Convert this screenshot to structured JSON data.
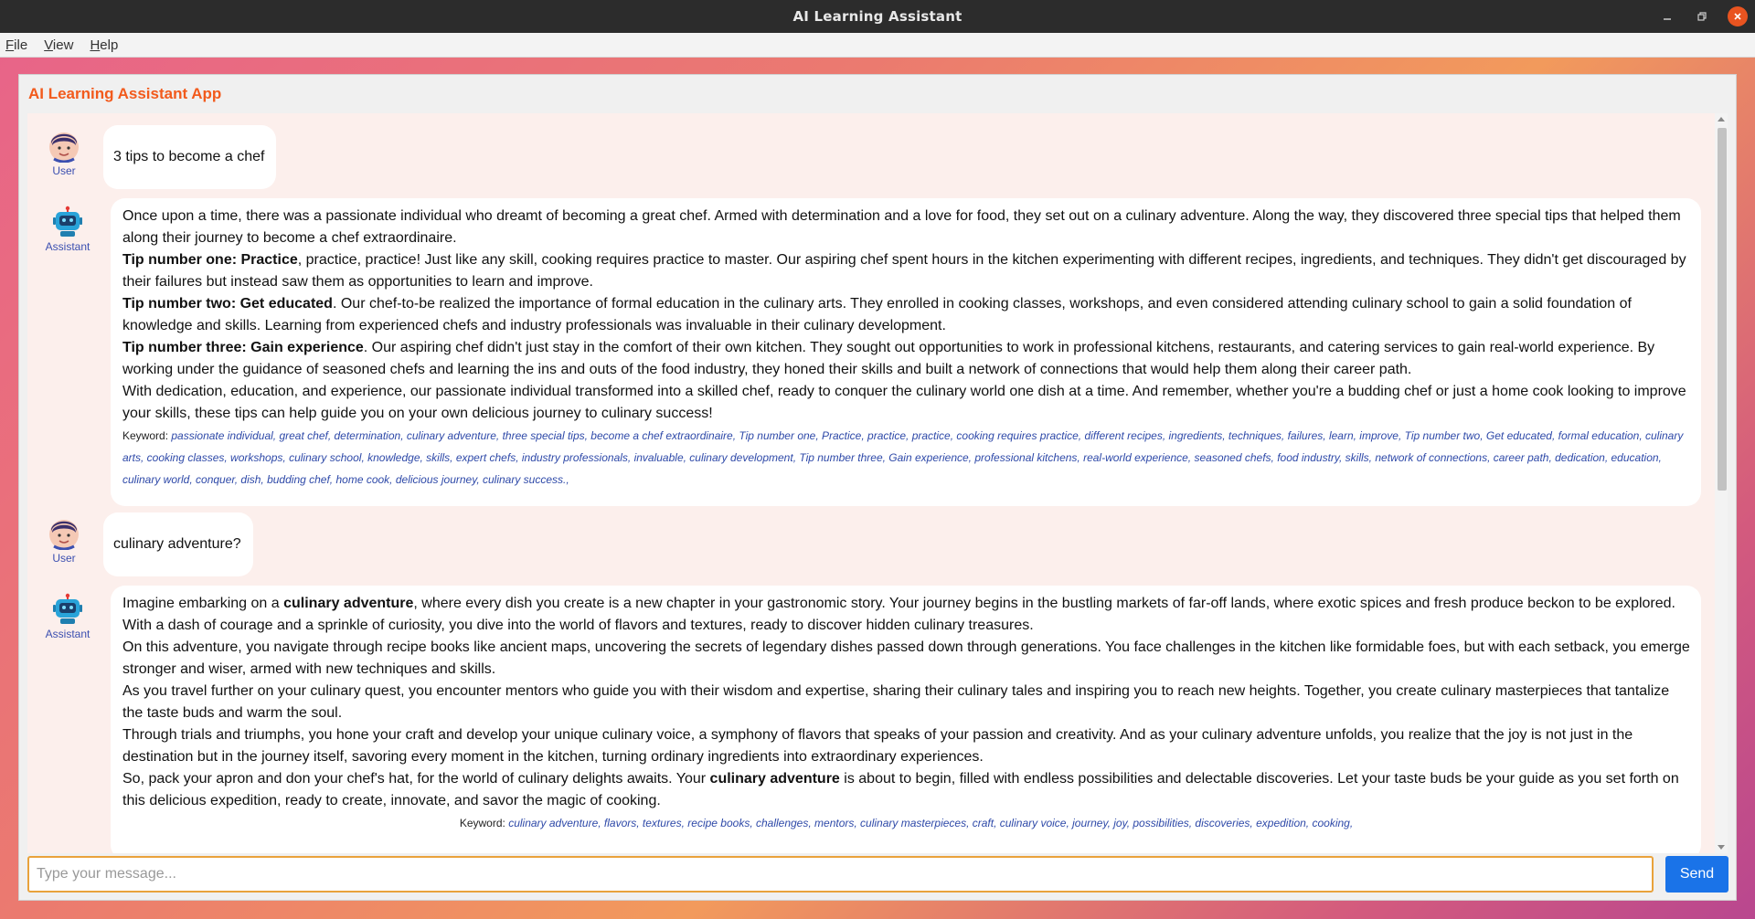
{
  "window": {
    "title": "AI Learning Assistant"
  },
  "menu": [
    {
      "underline": "F",
      "rest": "ile"
    },
    {
      "underline": "V",
      "rest": "iew"
    },
    {
      "underline": "H",
      "rest": "elp"
    }
  ],
  "app": {
    "title": "AI Learning Assistant App"
  },
  "labels": {
    "user": "User",
    "assistant": "Assistant",
    "keyword": "Keyword:"
  },
  "messages": {
    "m1": {
      "text": "3 tips to become a chef"
    },
    "m2": {
      "p1": "Once upon a time, there was a passionate individual who dreamt of becoming a great chef. Armed with determination and a love for food, they set out on a culinary adventure. Along the way, they discovered three special tips that helped them along their journey to become a chef extraordinaire.",
      "p2_b": "Tip number one: Practice",
      "p2": ", practice, practice! Just like any skill, cooking requires practice to master. Our aspiring chef spent hours in the kitchen experimenting with different recipes, ingredients, and techniques. They didn't get discouraged by their failures but instead saw them as opportunities to learn and improve.",
      "p3_b": "Tip number two: Get educated",
      "p3": ". Our chef-to-be realized the importance of formal education in the culinary arts. They enrolled in cooking classes, workshops, and even considered attending culinary school to gain a solid foundation of knowledge and skills. Learning from experienced chefs and industry professionals was invaluable in their culinary development.",
      "p4_b": "Tip number three: Gain experience",
      "p4": ". Our aspiring chef didn't just stay in the comfort of their own kitchen. They sought out opportunities to work in professional kitchens, restaurants, and catering services to gain real-world experience. By working under the guidance of seasoned chefs and learning the ins and outs of the food industry, they honed their skills and built a network of connections that would help them along their career path.",
      "p5": "With dedication, education, and experience, our passionate individual transformed into a skilled chef, ready to conquer the culinary world one dish at a time. And remember, whether you're a budding chef or just a home cook looking to improve your skills, these tips can help guide you on your own delicious journey to culinary success!",
      "keywords": "passionate individual, great chef, determination, culinary adventure, three special tips, become a chef extraordinaire, Tip number one, Practice, practice, practice, cooking requires practice, different recipes, ingredients, techniques, failures, learn, improve, Tip number two, Get educated, formal education, culinary arts, cooking classes, workshops, culinary school, knowledge, skills, expert chefs, industry professionals, invaluable, culinary development, Tip number three, Gain experience, professional kitchens, real-world experience, seasoned chefs, food industry, skills, network of connections, career path, dedication, education, culinary world, conquer, dish, budding chef, home cook, delicious journey, culinary success.,"
    },
    "m3": {
      "text": "culinary adventure?"
    },
    "m4": {
      "p1_a": "Imagine embarking on a ",
      "p1_b": "culinary adventure",
      "p1_c": ", where every dish you create is a new chapter in your gastronomic story. Your journey begins in the bustling markets of far-off lands, where exotic spices and fresh produce beckon to be explored. With a dash of courage and a sprinkle of curiosity, you dive into the world of flavors and textures, ready to discover hidden culinary treasures.",
      "p2": "On this adventure, you navigate through recipe books like ancient maps, uncovering the secrets of legendary dishes passed down through generations. You face challenges in the kitchen like formidable foes, but with each setback, you emerge stronger and wiser, armed with new techniques and skills.",
      "p3": "As you travel further on your culinary quest, you encounter mentors who guide you with their wisdom and expertise, sharing their culinary tales and inspiring you to reach new heights. Together, you create culinary masterpieces that tantalize the taste buds and warm the soul.",
      "p4": "Through trials and triumphs, you hone your craft and develop your unique culinary voice, a symphony of flavors that speaks of your passion and creativity. And as your culinary adventure unfolds, you realize that the joy is not just in the destination but in the journey itself, savoring every moment in the kitchen, turning ordinary ingredients into extraordinary experiences.",
      "p5_a": "So, pack your apron and don your chef's hat, for the world of culinary delights awaits. Your ",
      "p5_b": "culinary adventure",
      "p5_c": " is about to begin, filled with endless possibilities and delectable discoveries. Let your taste buds be your guide as you set forth on this delicious expedition, ready to create, innovate, and savor the magic of cooking.",
      "keywords": "culinary adventure, flavors, textures, recipe books, challenges, mentors, culinary masterpieces, craft, culinary voice, journey, joy, possibilities, discoveries, expedition, cooking,"
    }
  },
  "input": {
    "placeholder": "Type your message..."
  },
  "send": {
    "label": "Send"
  },
  "icons": {
    "minimize": "minimize-icon",
    "restore": "restore-icon",
    "close": "close-icon",
    "user": "user-avatar-icon",
    "assistant": "robot-avatar-icon"
  },
  "colors": {
    "accent": "#f25a1c",
    "send": "#1a73e8",
    "input_border": "#e9a23b",
    "label": "#3b4fb0"
  }
}
